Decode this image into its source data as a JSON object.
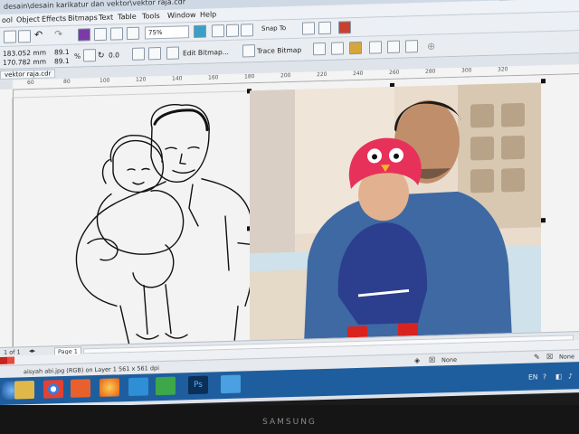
{
  "window": {
    "title": "desain\\desain karikatur dan vektor\\vektor raja.cdr"
  },
  "menu": [
    "ool",
    "Object",
    "Effects",
    "Bitmaps",
    "Text",
    "Table",
    "Tools",
    "Window",
    "Help"
  ],
  "toolbar": {
    "zoom": "75%",
    "snap_to": "Snap To",
    "edit_bitmap": "Edit Bitmap...",
    "trace_bitmap": "Trace Bitmap"
  },
  "properties": {
    "width": "183.052 mm",
    "height": "170.782 mm",
    "scale_x": "89.1",
    "scale_y": "89.1",
    "percent": "%",
    "rotation": "0.0"
  },
  "document_tab": "vektor raja.cdr",
  "ruler_labels": [
    "60",
    "80",
    "100",
    "120",
    "140",
    "160",
    "180",
    "200",
    "220",
    "240",
    "260",
    "280",
    "300",
    "320"
  ],
  "page_nav": {
    "page_count": "1 of 1",
    "page_label": "Page 1"
  },
  "status": {
    "object_info": "aisyah abi.jpg (RGB) on Layer 1 561 x 561 dpi",
    "fill_none": "None",
    "outline_none": "None"
  },
  "tray": {
    "lang": "EN"
  },
  "bezel_brand": "SAMSUNG",
  "colors": {
    "taskbar": "#1f5e9e",
    "shirt": "#3f69a3",
    "hat": "#e8315a",
    "dress": "#2c3f8f"
  }
}
